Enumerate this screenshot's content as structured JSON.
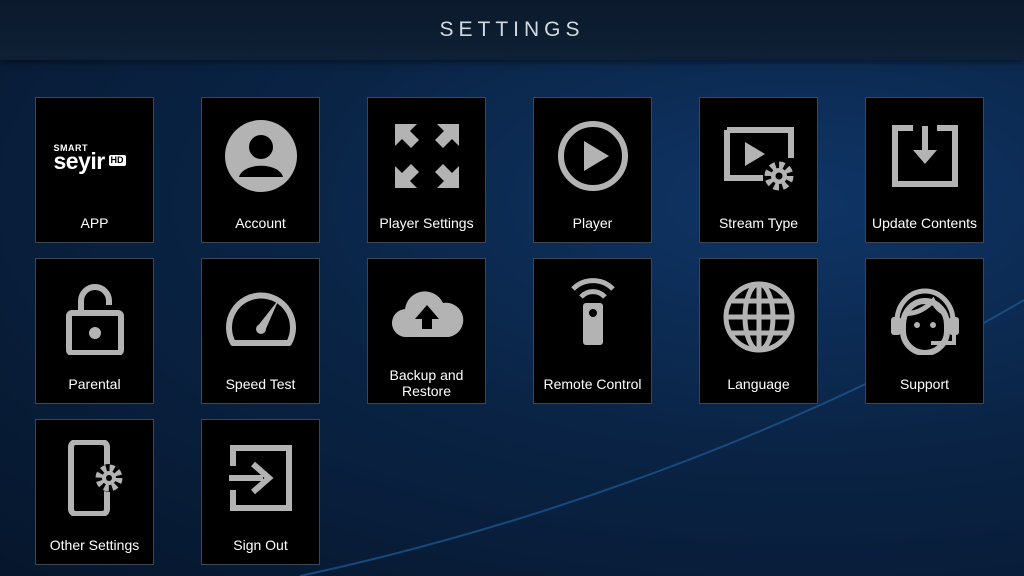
{
  "header": {
    "title": "SETTINGS"
  },
  "app_logo": {
    "small": "SMART",
    "main": "seyir",
    "badge": "HD"
  },
  "tiles": [
    {
      "label": "APP",
      "icon": "app-logo"
    },
    {
      "label": "Account",
      "icon": "account-icon"
    },
    {
      "label": "Player Settings",
      "icon": "expand-arrows-icon"
    },
    {
      "label": "Player",
      "icon": "play-circle-icon"
    },
    {
      "label": "Stream Type",
      "icon": "stream-settings-icon"
    },
    {
      "label": "Update Contents",
      "icon": "download-box-icon"
    },
    {
      "label": "Parental",
      "icon": "unlock-icon"
    },
    {
      "label": "Speed Test",
      "icon": "speedometer-icon"
    },
    {
      "label": "Backup and Restore",
      "icon": "cloud-upload-icon"
    },
    {
      "label": "Remote Control",
      "icon": "remote-control-icon"
    },
    {
      "label": "Language",
      "icon": "globe-icon"
    },
    {
      "label": "Support",
      "icon": "headset-icon"
    },
    {
      "label": "Other Settings",
      "icon": "phone-settings-icon"
    },
    {
      "label": "Sign Out",
      "icon": "sign-out-icon"
    }
  ],
  "colors": {
    "icon": "#b3b3b3",
    "tile_bg": "#000000",
    "tile_border": "#3c4654",
    "header_bg": "#0e2036"
  }
}
